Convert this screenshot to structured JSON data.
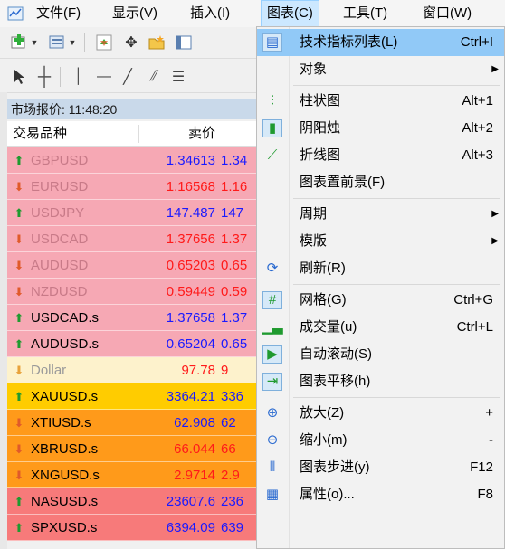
{
  "menubar": {
    "items": [
      "文件(F)",
      "显示(V)",
      "插入(I)",
      "图表(C)",
      "工具(T)",
      "窗口(W)"
    ]
  },
  "market_watch": {
    "title": "市场报价: 11:48:20",
    "col_symbol": "交易品种",
    "col_bid": "卖价",
    "rows": [
      {
        "symbol": "GBPUSD",
        "bid": "1.34613",
        "ask": "1.34",
        "dir": "up",
        "bg": "#f6a8b4",
        "symColor": "#c87a88",
        "bidColor": "#1a1aff"
      },
      {
        "symbol": "EURUSD",
        "bid": "1.16568",
        "ask": "1.16",
        "dir": "down",
        "bg": "#f6a8b4",
        "symColor": "#c87a88",
        "bidColor": "#ff1a1a"
      },
      {
        "symbol": "USDJPY",
        "bid": "147.487",
        "ask": "147",
        "dir": "up",
        "bg": "#f6a8b4",
        "symColor": "#c87a88",
        "bidColor": "#1a1aff"
      },
      {
        "symbol": "USDCAD",
        "bid": "1.37656",
        "ask": "1.37",
        "dir": "down",
        "bg": "#f6a8b4",
        "symColor": "#c87a88",
        "bidColor": "#ff1a1a"
      },
      {
        "symbol": "AUDUSD",
        "bid": "0.65203",
        "ask": "0.65",
        "dir": "down",
        "bg": "#f6a8b4",
        "symColor": "#c87a88",
        "bidColor": "#ff1a1a"
      },
      {
        "symbol": "NZDUSD",
        "bid": "0.59449",
        "ask": "0.59",
        "dir": "down",
        "bg": "#f6a8b4",
        "symColor": "#c87a88",
        "bidColor": "#ff1a1a"
      },
      {
        "symbol": "USDCAD.s",
        "bid": "1.37658",
        "ask": "1.37",
        "dir": "up",
        "bg": "#f6a8b4",
        "symColor": "#000000",
        "bidColor": "#1a1aff"
      },
      {
        "symbol": "AUDUSD.s",
        "bid": "0.65204",
        "ask": "0.65",
        "dir": "up",
        "bg": "#f6a8b4",
        "symColor": "#000000",
        "bidColor": "#1a1aff"
      },
      {
        "symbol": "Dollar",
        "bid": "97.78",
        "ask": "9",
        "dir": "down-light",
        "bg": "#fdf2cc",
        "symColor": "#9a9a9a",
        "bidColor": "#ff1a1a"
      },
      {
        "symbol": "XAUUSD.s",
        "bid": "3364.21",
        "ask": "336",
        "dir": "up",
        "bg": "#ffcc00",
        "symColor": "#000000",
        "bidColor": "#1a1aff"
      },
      {
        "symbol": "XTIUSD.s",
        "bid": "62.908",
        "ask": "62",
        "dir": "down",
        "bg": "#ff9a1a",
        "symColor": "#000000",
        "bidColor": "#1a1aff"
      },
      {
        "symbol": "XBRUSD.s",
        "bid": "66.044",
        "ask": "66",
        "dir": "down",
        "bg": "#ff9a1a",
        "symColor": "#000000",
        "bidColor": "#ff1a1a"
      },
      {
        "symbol": "XNGUSD.s",
        "bid": "2.9714",
        "ask": "2.9",
        "dir": "down",
        "bg": "#ff9a1a",
        "symColor": "#000000",
        "bidColor": "#ff1a1a"
      },
      {
        "symbol": "NASUSD.s",
        "bid": "23607.6",
        "ask": "236",
        "dir": "up",
        "bg": "#f77a7a",
        "symColor": "#000000",
        "bidColor": "#1a1aff"
      },
      {
        "symbol": "SPXUSD.s",
        "bid": "6394.09",
        "ask": "639",
        "dir": "up",
        "bg": "#f77a7a",
        "symColor": "#000000",
        "bidColor": "#1a1aff"
      }
    ]
  },
  "chart_menu": {
    "items": [
      {
        "label": "技术指标列表(L)",
        "shortcut": "Ctrl+I",
        "icon": "indicators-list-icon",
        "glyph": "▤",
        "highlight": true
      },
      {
        "label": "对象",
        "shortcut": "",
        "icon": "",
        "glyph": "",
        "submenu": true
      },
      {
        "sep": true
      },
      {
        "label": "柱状图",
        "shortcut": "Alt+1",
        "icon": "bar-chart-icon",
        "glyph": "⫶"
      },
      {
        "label": "阴阳烛",
        "shortcut": "Alt+2",
        "icon": "candlestick-icon",
        "glyph": "▮",
        "boxed": true
      },
      {
        "label": "折线图",
        "shortcut": "Alt+3",
        "icon": "line-chart-icon",
        "glyph": "⟋"
      },
      {
        "label": "图表置前景(F)",
        "shortcut": "",
        "icon": "",
        "glyph": ""
      },
      {
        "sep": true
      },
      {
        "label": "周期",
        "shortcut": "",
        "icon": "",
        "glyph": "",
        "submenu": true
      },
      {
        "label": "模版",
        "shortcut": "",
        "icon": "",
        "glyph": "",
        "submenu": true
      },
      {
        "label": "刷新(R)",
        "shortcut": "",
        "icon": "refresh-icon",
        "glyph": "⟳"
      },
      {
        "sep": true
      },
      {
        "label": "网格(G)",
        "shortcut": "Ctrl+G",
        "icon": "grid-icon",
        "glyph": "#",
        "boxed": true
      },
      {
        "label": "成交量(u)",
        "shortcut": "Ctrl+L",
        "icon": "volume-icon",
        "glyph": "▁▃"
      },
      {
        "label": "自动滚动(S)",
        "shortcut": "",
        "icon": "auto-scroll-icon",
        "glyph": "▶",
        "boxed": true
      },
      {
        "label": "图表平移(h)",
        "shortcut": "",
        "icon": "chart-shift-icon",
        "glyph": "⇥",
        "boxed": true
      },
      {
        "sep": true
      },
      {
        "label": "放大(Z)",
        "shortcut": "+",
        "icon": "zoom-in-icon",
        "glyph": "⊕"
      },
      {
        "label": "缩小(m)",
        "shortcut": "-",
        "icon": "zoom-out-icon",
        "glyph": "⊖"
      },
      {
        "label": "图表步进(y)",
        "shortcut": "F12",
        "icon": "step-icon",
        "glyph": "⫴"
      },
      {
        "label": "属性(o)...",
        "shortcut": "F8",
        "icon": "properties-icon",
        "glyph": "▦"
      }
    ]
  },
  "colors": {
    "up_arrow": "#1f9a2f",
    "down_arrow": "#e05a2a",
    "down_light_arrow": "#e8a23a",
    "menu_highlight": "#91c9f7"
  }
}
